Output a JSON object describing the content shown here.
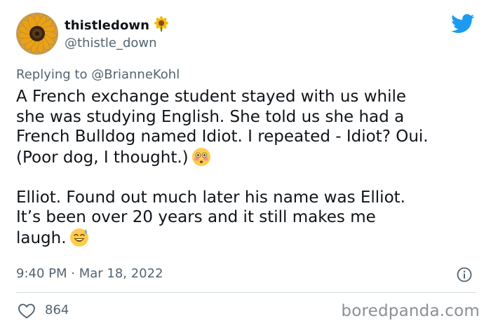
{
  "user": {
    "display_name": "thistledown",
    "name_emoji": "sunflower",
    "handle": "@thistle_down",
    "avatar": "sunflower-avatar"
  },
  "reply": {
    "prefix": "Replying to",
    "mention": "@BrianneKohl"
  },
  "body": {
    "paragraph1": [
      "A French exchange student stayed with us while",
      "she was studying English. She told us she had a",
      "French Bulldog named Idiot. I repeated - Idiot? Oui.",
      "(Poor dog, I thought.)"
    ],
    "paragraph1_emoji": "flushed-face",
    "paragraph2": [
      "Elliot. Found out much later his name was Elliot.",
      "It’s been over 20 years and it still makes me",
      "laugh."
    ],
    "paragraph2_emoji": "grinning-face-with-sweat"
  },
  "meta": {
    "timestamp": "9:40 PM · Mar 18, 2022"
  },
  "stats": {
    "likes": "864"
  },
  "watermark": "boredpanda.com",
  "colors": {
    "text": "#0f1419",
    "secondary": "#536471",
    "twitter_blue": "#1d9bf0",
    "divider": "#cfd9de",
    "watermark": "#8a8f94"
  },
  "icons": {
    "brand": "twitter-bird-icon",
    "info": "info-icon",
    "like": "heart-icon"
  }
}
